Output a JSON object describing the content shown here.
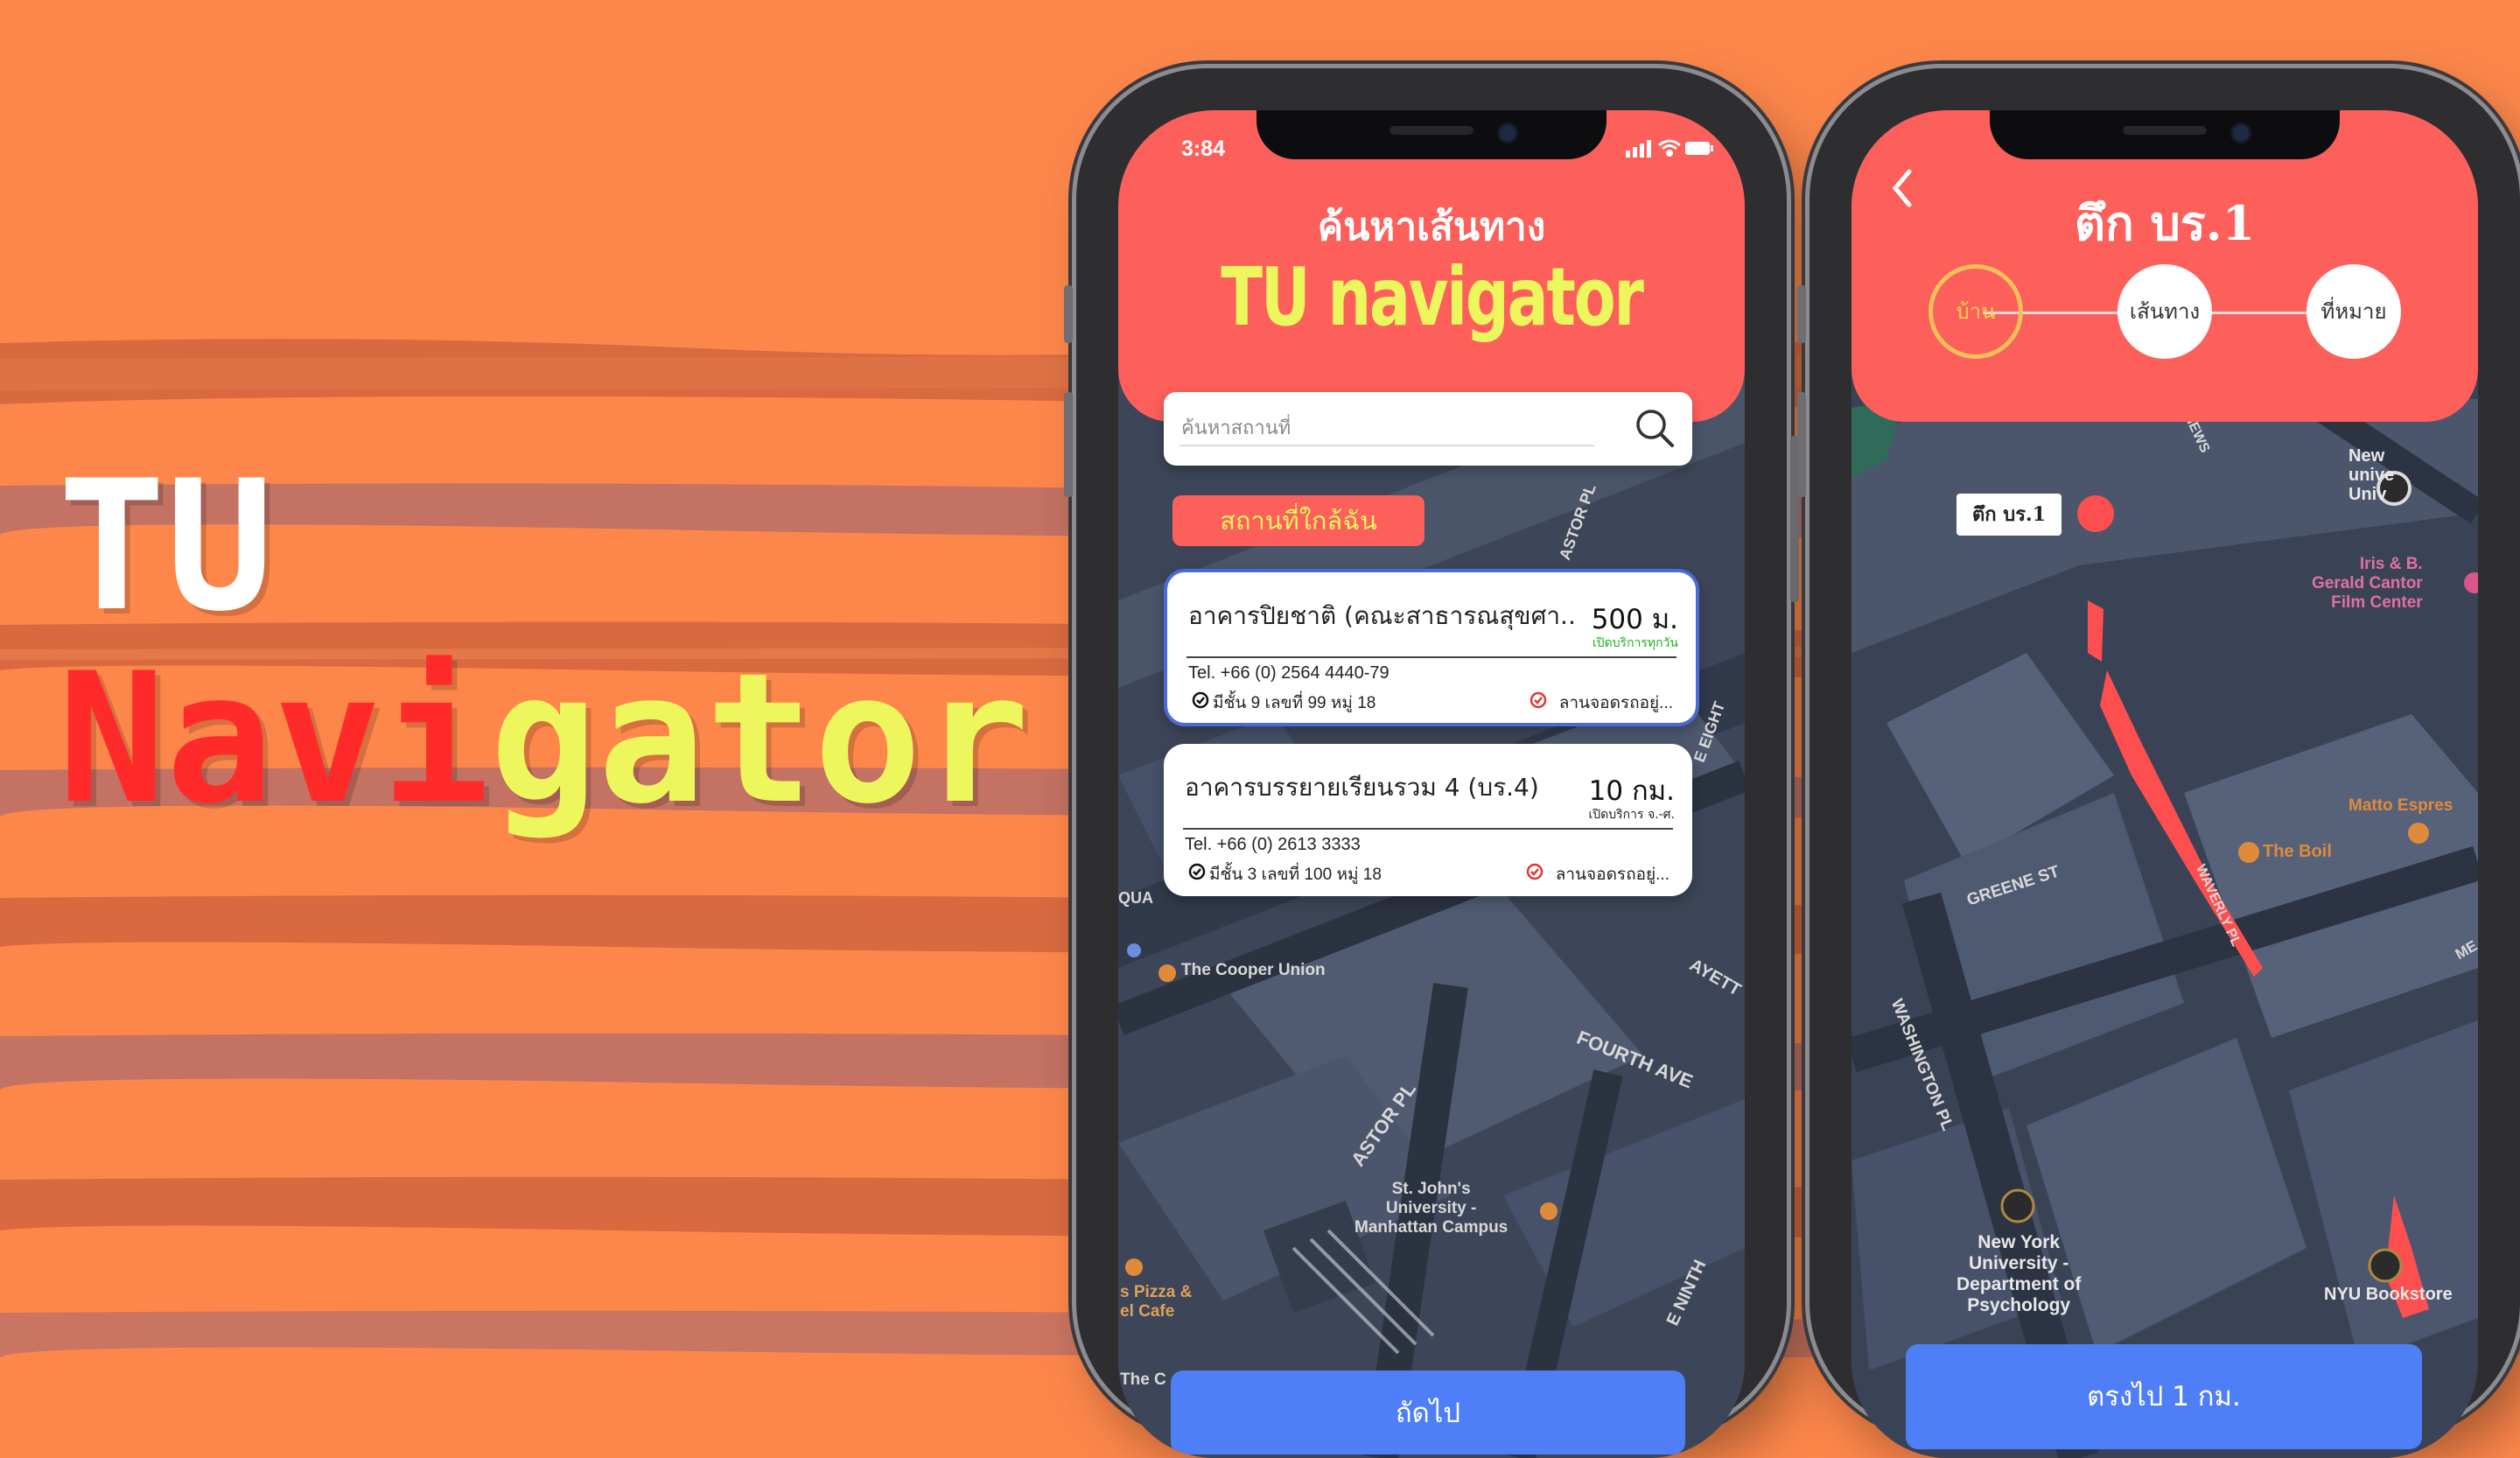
{
  "hero": {
    "line1": "TU",
    "line2_red": "Navi",
    "line2_yellow": "gator"
  },
  "left_phone": {
    "status_time": "3:84",
    "header_subtitle": "ค้นหาเส้นทาง",
    "header_title": "TU navigator",
    "search": {
      "placeholder": "ค้นหาสถานที่"
    },
    "nearby_label": "สถานที่ใกล้ฉัน",
    "places": [
      {
        "name": "อาคารปิยชาติ (คณะสาธารณสุขศา..",
        "distance": "500 ม.",
        "status": "เปิดบริการทุกวัน",
        "tel": "Tel. +66 (0) 2564 4440-79",
        "address": "มีชั้น 9 เลขที่ 99 หมู่ 18",
        "parking": "ลานจอดรถอยู่..."
      },
      {
        "name": "อาคารบรรยายเรียนรวม 4 (บร.4)",
        "distance": "10 กม.",
        "status": "เปิดบริการ จ.-ศ.",
        "tel": "Tel. +66 (0) 2613 3333",
        "address": "มีชั้น 3 เลขที่ 100 หมู่ 18",
        "parking": "ลานจอดรถอยู่..."
      }
    ],
    "next_button": "ถัดไป",
    "map_labels": {
      "cooper": "The Cooper Union",
      "fourth_ave": "FOURTH AVE",
      "astor_pl": "ASTOR PL",
      "astor_pl_top": "ASTOR PL",
      "stjohns": "St. John's\nUniversity -\nManhattan Campus",
      "pizza": "s Pizza &\nel Cafe",
      "the_c": "The C",
      "e_ninth": "E NINTH",
      "lafayette": "AYETT",
      "e_eighth": "E EIGHT",
      "qua": "QUA"
    }
  },
  "right_phone": {
    "title": "ตึก บร.1",
    "steps": [
      "บ้าน",
      "เส้นทาง",
      "ที่หมาย"
    ],
    "building_label": "ตึก บร.1",
    "go_button": "ตรงไป 1 กม.",
    "map_labels": {
      "new_univ": "New\nunive\nUniv",
      "iris": "Iris & B.\nGerald Cantor\nFilm Center",
      "matto": "Matto Espres",
      "boil": "The Boil",
      "greene": "GREENE ST",
      "waverly": "WAVERLY PL",
      "washington": "WASHINGTON PL",
      "nyu_psych": "New York\nUniversity -\nDepartment of\nPsychology",
      "nyu_books": "NYU Bookstore",
      "news": "NEWS",
      "me": "ME"
    }
  },
  "colors": {
    "background": "#fd874b",
    "header": "#fd5f5b",
    "title_yellow": "#eef65e",
    "hero_red": "#ff2b2b",
    "button_blue": "#4f7ff7",
    "map_base": "#3d4658",
    "route_red": "#fd4f4f"
  },
  "icons": [
    "search-icon",
    "signal-icon",
    "wifi-icon",
    "battery-icon",
    "back-arrow-icon",
    "check-circle-icon",
    "pin-check-icon"
  ]
}
